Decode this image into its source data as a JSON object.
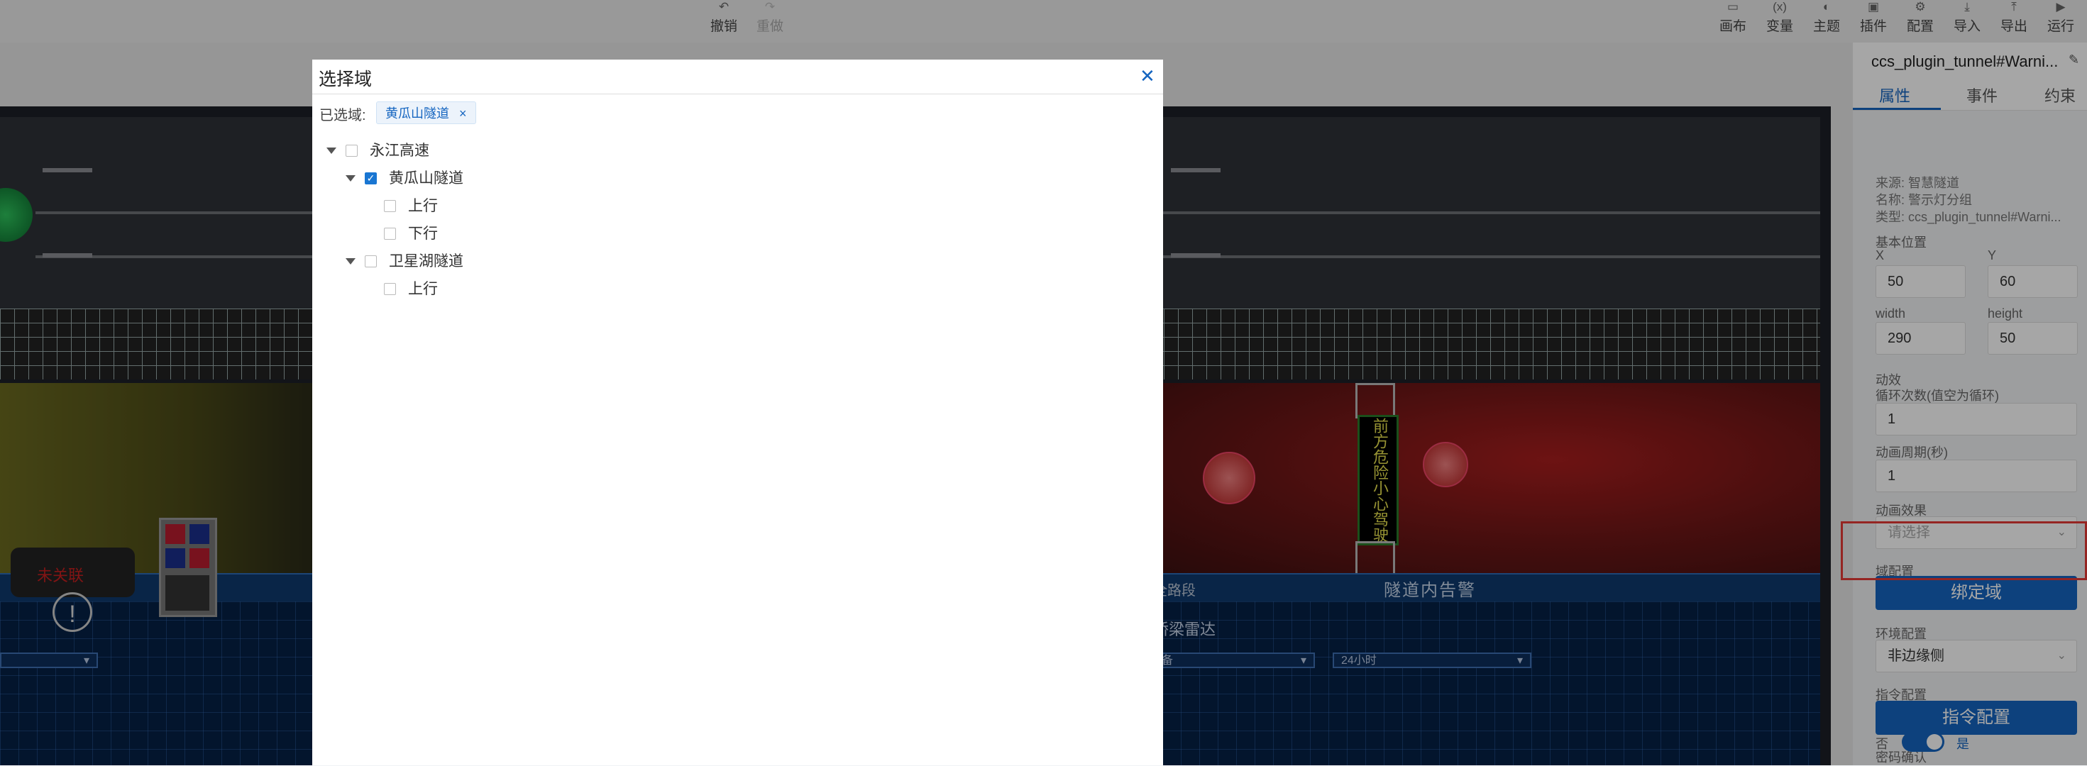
{
  "toolbar": {
    "undo": "撤销",
    "redo": "重做",
    "right_items": [
      {
        "label": "画布",
        "icon": "canvas-icon"
      },
      {
        "label": "变量",
        "icon": "variable-icon"
      },
      {
        "label": "主题",
        "icon": "theme-icon"
      },
      {
        "label": "插件",
        "icon": "plugin-icon"
      },
      {
        "label": "配置",
        "icon": "config-icon"
      },
      {
        "label": "导入",
        "icon": "import-icon"
      },
      {
        "label": "导出",
        "icon": "export-icon"
      },
      {
        "label": "运行",
        "icon": "run-icon"
      }
    ]
  },
  "canvas": {
    "unlinked_text": "未关联",
    "tunnel_alert": "隧道内告警",
    "segment_label": "全路段",
    "radar_label": "桥梁雷达",
    "sign_text": "前方危险小心驾驶",
    "select_value": "24小时",
    "select_left_value": "备"
  },
  "dialog": {
    "title": "选择域",
    "selected_label": "已选域:",
    "selected_tags": [
      "黄瓜山隧道"
    ],
    "tree": [
      {
        "label": "永江高速",
        "checked": false,
        "expanded": true,
        "level": 0
      },
      {
        "label": "黄瓜山隧道",
        "checked": true,
        "expanded": true,
        "level": 1
      },
      {
        "label": "上行",
        "checked": false,
        "level": 2
      },
      {
        "label": "下行",
        "checked": false,
        "level": 2
      },
      {
        "label": "卫星湖隧道",
        "checked": false,
        "expanded": true,
        "level": 1
      },
      {
        "label": "上行",
        "checked": false,
        "level": 2
      }
    ]
  },
  "panel": {
    "title": "ccs_plugin_tunnel#Warni...",
    "tabs": [
      "属性",
      "事件",
      "约束"
    ],
    "source": "来源: 智慧隧道",
    "name": "名称: 警示灯分组",
    "type": "类型: ccs_plugin_tunnel#Warni...",
    "position_label": "基本位置",
    "x_label": "X",
    "y_label": "Y",
    "x_value": "50",
    "y_value": "60",
    "width_label": "width",
    "height_label": "height",
    "width_value": "290",
    "height_value": "50",
    "animation_label": "动效",
    "loop_label": "循环次数(值空为循环)",
    "loop_value": "1",
    "period_label": "动画周期(秒)",
    "period_value": "1",
    "effect_label": "动画效果",
    "effect_placeholder": "请选择",
    "domain_label": "域配置",
    "bind_domain": "绑定域",
    "env_label": "环境配置",
    "env_value": "非边缘侧",
    "command_label": "指令配置",
    "command_button": "指令配置",
    "password_label": "密码确认",
    "no": "否",
    "yes": "是"
  },
  "colors": {
    "accent": "#1565c0",
    "highlight": "#e53935"
  }
}
